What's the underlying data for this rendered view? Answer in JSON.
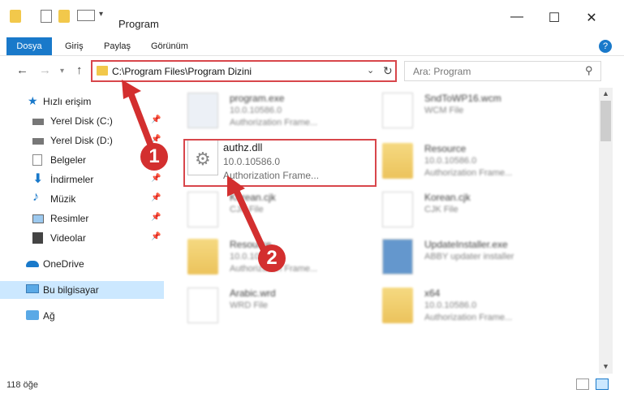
{
  "window": {
    "title": "Program",
    "minimize": "—",
    "maximize": "☐",
    "close": "✕",
    "help": "?"
  },
  "ribbon": {
    "tabs": [
      "Dosya",
      "Giriş",
      "Paylaş",
      "Görünüm"
    ]
  },
  "nav": {
    "back": "←",
    "forward": "→",
    "up": "↑",
    "address": "C:\\Program Files\\Program Dizini",
    "search_placeholder": "Ara: Program"
  },
  "sidebar": {
    "items": [
      {
        "label": "Hızlı erişim",
        "icon": "star-icon",
        "pinned": false
      },
      {
        "label": "Yerel Disk (C:)",
        "icon": "drive-icon",
        "pinned": true
      },
      {
        "label": "Yerel Disk (D:)",
        "icon": "drive-icon",
        "pinned": true
      },
      {
        "label": "Belgeler",
        "icon": "documents-icon",
        "pinned": true
      },
      {
        "label": "İndirmeler",
        "icon": "download-icon",
        "pinned": true
      },
      {
        "label": "Müzik",
        "icon": "music-icon",
        "pinned": true
      },
      {
        "label": "Resimler",
        "icon": "pictures-icon",
        "pinned": true
      },
      {
        "label": "Videolar",
        "icon": "videos-icon",
        "pinned": true
      },
      {
        "label": "OneDrive",
        "icon": "cloud-icon",
        "pinned": false
      },
      {
        "label": "Bu bilgisayar",
        "icon": "computer-icon",
        "pinned": false
      },
      {
        "label": "Ağ",
        "icon": "network-icon",
        "pinned": false
      }
    ]
  },
  "files": [
    {
      "name": "program.exe",
      "version": "10.0.10586.0",
      "desc": "Authorization Frame...",
      "kind": "exe"
    },
    {
      "name": "SndToWP16.wcm",
      "version": "WCM File",
      "desc": "",
      "kind": "doc"
    },
    {
      "name": "authz.dll",
      "version": "10.0.10586.0",
      "desc": "Authorization Frame...",
      "kind": "dll"
    },
    {
      "name": "Resource",
      "version": "10.0.10586.0",
      "desc": "Authorization Frame...",
      "kind": "folder"
    },
    {
      "name": "Korean.cjk",
      "version": "CJK File",
      "desc": "",
      "kind": "doc"
    },
    {
      "name": "Korean.cjk",
      "version": "CJK File",
      "desc": "",
      "kind": "doc"
    },
    {
      "name": "Resource",
      "version": "10.0.10586.0",
      "desc": "Authorization Frame...",
      "kind": "folder"
    },
    {
      "name": "UpdateInstaller.exe",
      "version": "ABBY updater installer",
      "desc": "",
      "kind": "exe"
    },
    {
      "name": "Arabic.wrd",
      "version": "WRD File",
      "desc": "",
      "kind": "doc"
    },
    {
      "name": "x64",
      "version": "10.0.10586.0",
      "desc": "Authorization Frame...",
      "kind": "folder"
    }
  ],
  "status": {
    "count": "118 öğe"
  },
  "annotations": {
    "step1": "1",
    "step2": "2"
  },
  "colors": {
    "accent": "#1979ca",
    "annotation": "#d32f2f",
    "selection": "#cce8ff"
  }
}
